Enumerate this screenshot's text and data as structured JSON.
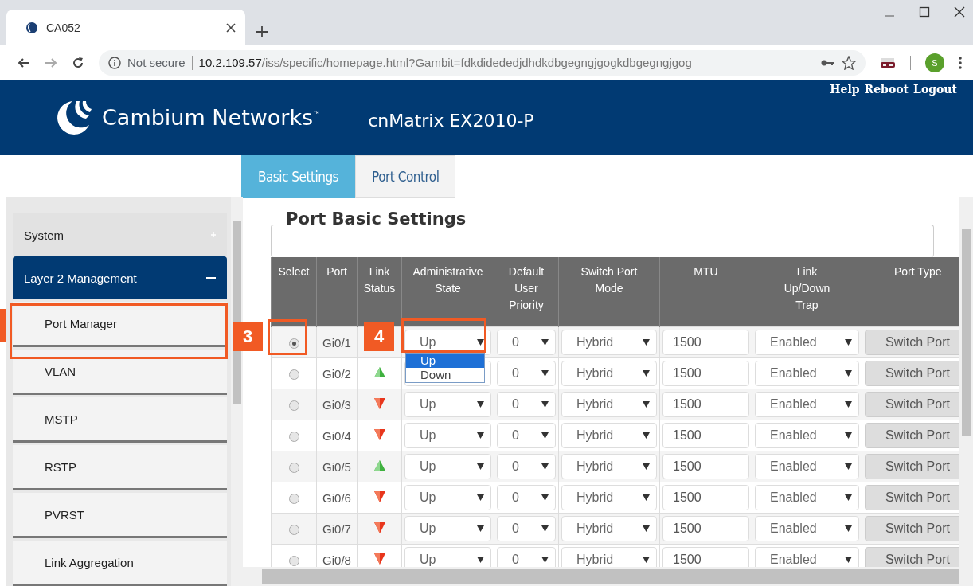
{
  "browser": {
    "tab_title": "CA052",
    "security": "Not secure",
    "url_host": "10.2.109.57",
    "url_path": "/iss/specific/homepage.html?Gambit=fdkdidededjdhdkdbgegngjgogkdbgegngjgog",
    "profile_initial": "S"
  },
  "header": {
    "brand": "Cambium Networks$^{™}$",
    "product": "cnMatrix EX2010-P",
    "links": [
      "Help",
      "Reboot",
      "Logout"
    ]
  },
  "tabs": [
    {
      "label": "Basic Settings",
      "selected": true
    },
    {
      "label": "Port Control",
      "selected": false
    }
  ],
  "sidebar": {
    "items": [
      {
        "kind": "section",
        "label": "System",
        "expanded": false
      },
      {
        "kind": "section",
        "label": "Layer 2 Management",
        "expanded": true
      },
      {
        "kind": "subitem",
        "label": "Port Manager"
      },
      {
        "kind": "subitem",
        "label": "VLAN"
      },
      {
        "kind": "subitem",
        "label": "MSTP"
      },
      {
        "kind": "subitem",
        "label": "RSTP"
      },
      {
        "kind": "subitem",
        "label": "PVRST"
      },
      {
        "kind": "subitem",
        "label": "Link Aggregation"
      }
    ]
  },
  "panel": {
    "title": "Port Basic Settings",
    "table": {
      "columns": [
        "Select",
        "Port",
        "Link\nStatus",
        "Administrative\nState",
        "Default\nUser\nPriority",
        "Switch Port\nMode",
        "MTU",
        "Link\nUp/Down\nTrap",
        "Port Type"
      ],
      "rows": [
        {
          "selected": true,
          "port": "Gi0/1",
          "admin": "Up",
          "priority": "0",
          "mode": "Hybrid",
          "mtu": "1500",
          "trap": "Enabled",
          "type": "Switch Port"
        },
        {
          "selected": false,
          "port": "Gi0/2",
          "link_up": true,
          "priority": "0",
          "mode": "Hybrid",
          "mtu": "1500",
          "trap": "Enabled",
          "type": "Switch Port"
        },
        {
          "selected": false,
          "port": "Gi0/3",
          "link_up": false,
          "admin": "Up",
          "priority": "0",
          "mode": "Hybrid",
          "mtu": "1500",
          "trap": "Enabled",
          "type": "Switch Port"
        },
        {
          "selected": false,
          "port": "Gi0/4",
          "link_up": false,
          "admin": "Up",
          "priority": "0",
          "mode": "Hybrid",
          "mtu": "1500",
          "trap": "Enabled",
          "type": "Switch Port"
        },
        {
          "selected": false,
          "port": "Gi0/5",
          "link_up": true,
          "admin": "Up",
          "priority": "0",
          "mode": "Hybrid",
          "mtu": "1500",
          "trap": "Enabled",
          "type": "Switch Port"
        },
        {
          "selected": false,
          "port": "Gi0/6",
          "link_up": false,
          "admin": "Up",
          "priority": "0",
          "mode": "Hybrid",
          "mtu": "1500",
          "trap": "Enabled",
          "type": "Switch Port"
        },
        {
          "selected": false,
          "port": "Gi0/7",
          "link_up": false,
          "admin": "Up",
          "priority": "0",
          "mode": "Hybrid",
          "mtu": "1500",
          "trap": "Enabled",
          "type": "Switch Port"
        },
        {
          "selected": false,
          "port": "Gi0/8",
          "link_up": false,
          "admin": "Up",
          "priority": "0",
          "mode": "Hybrid",
          "mtu": "1500",
          "trap": "Enabled",
          "type": "Switch Port"
        }
      ],
      "admin_dropdown": {
        "options": [
          {
            "label": "Up",
            "selected": true
          },
          {
            "label": "Down",
            "selected": false
          }
        ]
      }
    }
  },
  "callouts": [
    "3",
    "4"
  ]
}
